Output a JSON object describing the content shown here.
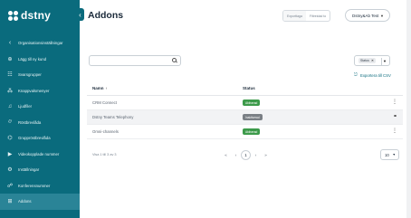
{
  "brand": {
    "logo_text": "dstny"
  },
  "sidebar": {
    "items": [
      {
        "label": "Organisationsinställningar",
        "icon": "chevron-left-icon",
        "glyph": "‹"
      },
      {
        "label": "Lägg till ny kund",
        "icon": "plus-circle-icon",
        "glyph": "⊕"
      },
      {
        "label": "Svarsgrupper",
        "icon": "group-icon",
        "glyph": "☷"
      },
      {
        "label": "Knappvalsmenyer",
        "icon": "menu-tree-icon",
        "glyph": "⁂"
      },
      {
        "label": "Ljudfiler",
        "icon": "audio-file-icon",
        "glyph": "♫"
      },
      {
        "label": "Röstbrevlåda",
        "icon": "voicemail-icon",
        "glyph": "⌭"
      },
      {
        "label": "Gruppröstbrevlåda",
        "icon": "group-voicemail-icon",
        "glyph": "⌬"
      },
      {
        "label": "Videokopplade nummer",
        "icon": "video-icon",
        "glyph": "▶"
      },
      {
        "label": "Inställningar",
        "icon": "gear-icon",
        "glyph": "⚙"
      },
      {
        "label": "Konferensnummer",
        "icon": "conference-icon",
        "glyph": "☍"
      },
      {
        "label": "Addons",
        "icon": "addons-icon",
        "glyph": "⊞"
      }
    ]
  },
  "header": {
    "title": "Addons",
    "toggle": [
      "Exporttaga",
      "Filtreidad to"
    ],
    "org_select": "Dstny&Ab Test"
  },
  "filters": {
    "search_placeholder": "",
    "status_chip": "Status",
    "export_label": "Exportera till CSV"
  },
  "table": {
    "columns": {
      "name": "Namn",
      "status": "Status"
    },
    "rows": [
      {
        "name": "CRM Connect",
        "status": "Aktiverad",
        "status_color": "#3c9a4a",
        "action": "⋮"
      },
      {
        "name": "Dstny Teams Telephony",
        "status": "Inaktiverad",
        "status_color": "#7a7f85",
        "action": "⚭"
      },
      {
        "name": "Omni-channels",
        "status": "Aktiverad",
        "status_color": "#3c9a4a",
        "action": "⋮"
      }
    ]
  },
  "pagination": {
    "summary": "Visa 1 till 3 av 3",
    "first": "«",
    "prev": "‹",
    "current": "1",
    "next": "›",
    "last": "»",
    "page_size": "10"
  }
}
